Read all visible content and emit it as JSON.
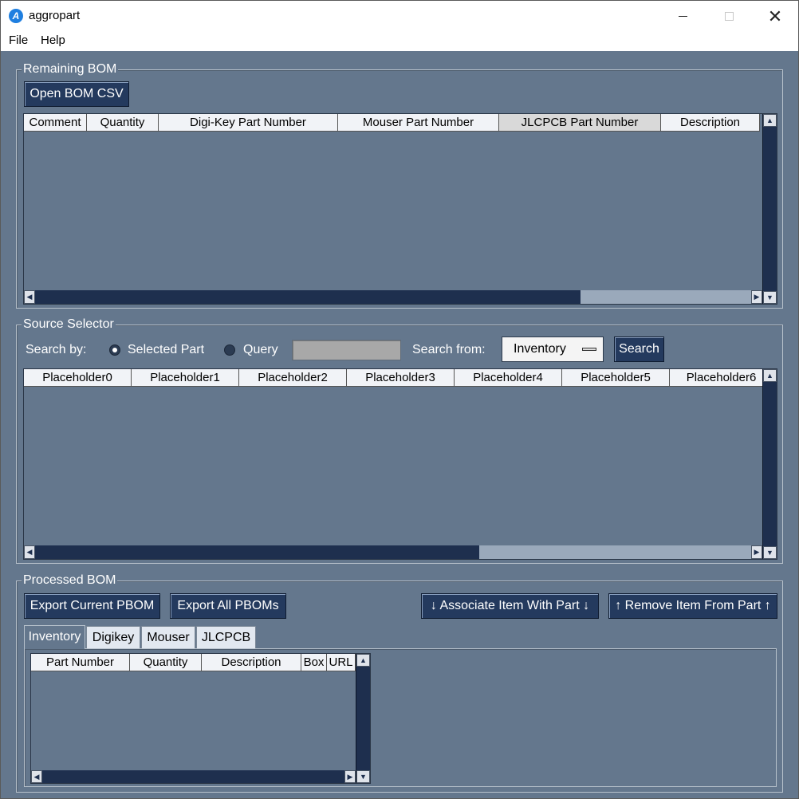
{
  "window": {
    "title": "aggropart",
    "app_icon": "aggropart-app-icon",
    "controls": [
      "minimize-icon",
      "maximize-icon",
      "close-icon"
    ]
  },
  "menu": {
    "items": [
      "File",
      "Help"
    ]
  },
  "colors": {
    "background": "#64778d",
    "button": "#243a5e",
    "scrollbar": "#1e2f4e"
  },
  "remaining_bom": {
    "title": "Remaining BOM",
    "open_button": "Open BOM CSV",
    "columns": [
      "Comment",
      "Quantity",
      "Digi-Key Part Number",
      "Mouser Part Number",
      "JLCPCB Part Number",
      "Description"
    ],
    "rows": []
  },
  "source_selector": {
    "title": "Source Selector",
    "search_by_label": "Search by:",
    "radio_selected_part": "Selected Part",
    "radio_query": "Query",
    "selected_mode": "Selected Part",
    "query_value": "",
    "search_from_label": "Search from:",
    "search_from_value": "Inventory",
    "search_button": "Search",
    "columns": [
      "Placeholder0",
      "Placeholder1",
      "Placeholder2",
      "Placeholder3",
      "Placeholder4",
      "Placeholder5",
      "Placeholder6"
    ],
    "rows": []
  },
  "processed_bom": {
    "title": "Processed BOM",
    "export_current": "Export Current PBOM",
    "export_all": "Export All PBOMs",
    "associate": "↓ Associate Item With Part ↓",
    "remove": "↑ Remove Item From Part ↑",
    "tabs": [
      "Inventory",
      "Digikey",
      "Mouser",
      "JLCPCB"
    ],
    "active_tab": "Inventory",
    "columns": [
      "Part Number",
      "Quantity",
      "Description",
      "Box",
      "URL"
    ],
    "rows": []
  }
}
